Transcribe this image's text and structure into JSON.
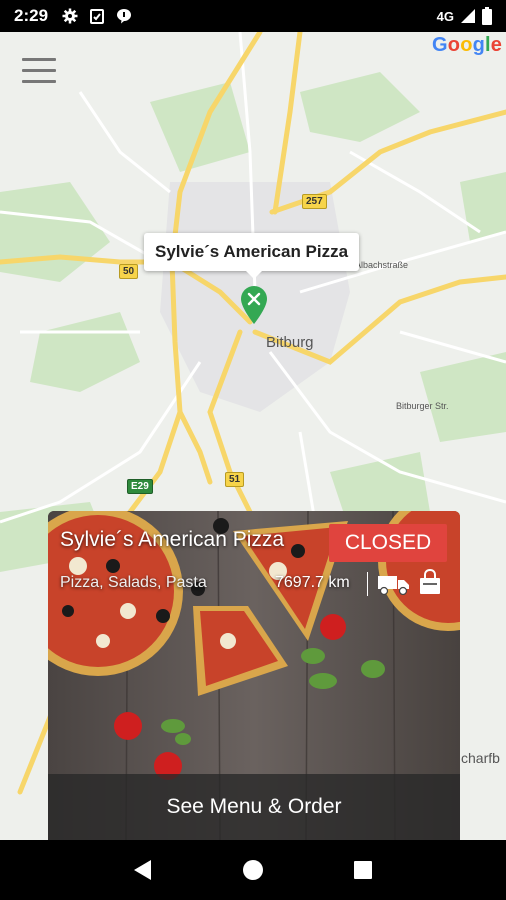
{
  "status_bar": {
    "time": "2:29",
    "network": "4G",
    "icons": [
      "settings-icon",
      "clipboard-icon",
      "chat-icon",
      "signal-icon",
      "battery-icon"
    ]
  },
  "map": {
    "brand": "Google",
    "place_label": "Bitburg",
    "street_labels": [
      "Albachstraße",
      "Bitburger Str.",
      "charfb"
    ],
    "road_numbers": [
      "257",
      "50",
      "51",
      "E29"
    ],
    "pin_name": "Sylvie´s American Pizza",
    "pin_color": "#34a853"
  },
  "restaurant_card": {
    "name": "Sylvie´s American Pizza",
    "status": "CLOSED",
    "cuisines": "Pizza, Salads, Pasta",
    "distance": "7697.7 km",
    "delivery_icon": "delivery-truck-icon",
    "takeaway_icon": "shopping-bag-icon",
    "action_label": "See Menu & Order",
    "status_color": "#e0443e"
  },
  "nav_bar": {
    "back": "back-icon",
    "home": "home-icon",
    "recents": "recents-icon"
  }
}
